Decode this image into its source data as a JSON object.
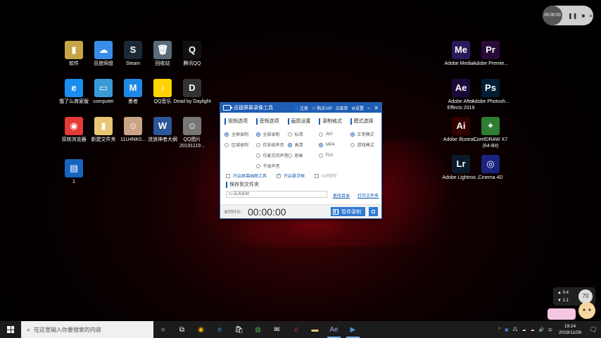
{
  "desktop": {
    "icons_left": [
      {
        "label": "软件",
        "glyph": "▮",
        "color": "#c8a448"
      },
      {
        "label": "百度网盘",
        "glyph": "☁",
        "color": "#3a8ee8"
      },
      {
        "label": "Steam",
        "glyph": "S",
        "color": "#1b2838"
      },
      {
        "label": "回收站",
        "glyph": "🗑",
        "color": "#5a6a7a"
      },
      {
        "label": "腾讯QQ",
        "glyph": "Q",
        "color": "#111"
      },
      {
        "label": "饿了么商家版",
        "glyph": "e",
        "color": "#1a8ef0"
      },
      {
        "label": "computer",
        "glyph": "▭",
        "color": "#3a9ad6"
      },
      {
        "label": "墨者",
        "glyph": "M",
        "color": "#1e88e5"
      },
      {
        "label": "QQ音乐",
        "glyph": "♪",
        "color": "#ffd400"
      },
      {
        "label": "Dead by Daylight",
        "glyph": "D",
        "color": "#333"
      },
      {
        "label": "双核浏览器",
        "glyph": "◉",
        "color": "#e53935"
      },
      {
        "label": "新建文件夹",
        "glyph": "▮",
        "color": "#e8c673"
      },
      {
        "label": "11U4NK0...",
        "glyph": "☺",
        "color": "#caa488"
      },
      {
        "label": "流浪神者大纲",
        "glyph": "W",
        "color": "#2b579a"
      },
      {
        "label": "QQ图片 20191119...",
        "glyph": "☺",
        "color": "#777"
      },
      {
        "label": "1",
        "glyph": "▤",
        "color": "#1565c0"
      }
    ],
    "icons_right": [
      {
        "label": "Adobe Media...",
        "glyph": "Me",
        "color": "#2a1a5c"
      },
      {
        "label": "Adobe Premie...",
        "glyph": "Pr",
        "color": "#2a0a3a"
      },
      {
        "label": "Adobe After Effects 2019",
        "glyph": "Ae",
        "color": "#1a0a3a"
      },
      {
        "label": "Adobe Photosh...",
        "glyph": "Ps",
        "color": "#001e36"
      },
      {
        "label": "Adobe Illustrat...",
        "glyph": "Ai",
        "color": "#330000"
      },
      {
        "label": "CorelDRAW X7 (64-Bit)",
        "glyph": "✦",
        "color": "#2e7d32"
      },
      {
        "label": "Adobe Lightroo...",
        "glyph": "Lr",
        "color": "#0a1a2a"
      },
      {
        "label": "Cinema 4D",
        "glyph": "◎",
        "color": "#1a237e"
      }
    ]
  },
  "floating_recorder": {
    "time": "00:00:00"
  },
  "recorder": {
    "title": "迅捷屏幕录像工具",
    "links": {
      "register": "注册",
      "buy_vip": "购买VIP",
      "menu": "菜单",
      "settings": "设置"
    },
    "sections": [
      {
        "header": "视频选项",
        "options": [
          {
            "label": "全屏录制",
            "selected": true
          },
          {
            "label": "区域录制",
            "selected": false
          }
        ]
      },
      {
        "header": "音频选项",
        "options": [
          {
            "label": "全部录制",
            "selected": true
          },
          {
            "label": "仅系统声音",
            "selected": false
          },
          {
            "label": "仅麦克风声音",
            "selected": false
          },
          {
            "label": "不录声音",
            "selected": false
          }
        ]
      },
      {
        "header": "画质设置",
        "options": [
          {
            "label": "标清",
            "selected": false
          },
          {
            "label": "高清",
            "selected": true
          },
          {
            "label": "原画",
            "selected": false
          }
        ]
      },
      {
        "header": "录制格式",
        "options": [
          {
            "label": "AVI",
            "selected": false
          },
          {
            "label": "MP4",
            "selected": true
          },
          {
            "label": "FLV",
            "selected": false
          }
        ]
      },
      {
        "header": "模式选择",
        "options": [
          {
            "label": "正常模式",
            "selected": true
          },
          {
            "label": "游戏模式",
            "selected": false
          }
        ]
      }
    ],
    "checkboxes": [
      {
        "label": "开启屏幕画图工具",
        "checked": false
      },
      {
        "label": "开启悬浮框",
        "checked": true
      },
      {
        "label": "GIF制作",
        "checked": false
      }
    ],
    "save": {
      "header": "保存到文件夹",
      "path": "D:\\高清录制",
      "change_dir": "更改目录",
      "open_folder": "打开文件夹"
    },
    "footer": {
      "duration_label": "录制时长：",
      "timer": "00:00:00",
      "pause_label": "暂停录制"
    }
  },
  "speed_widget": {
    "up": "0.4",
    "down": "2.1",
    "percent": "70"
  },
  "taskbar": {
    "search_placeholder": "在这里输入你要搜索的内容",
    "time": "19:24",
    "date": "2019/11/26",
    "ime": "中"
  }
}
